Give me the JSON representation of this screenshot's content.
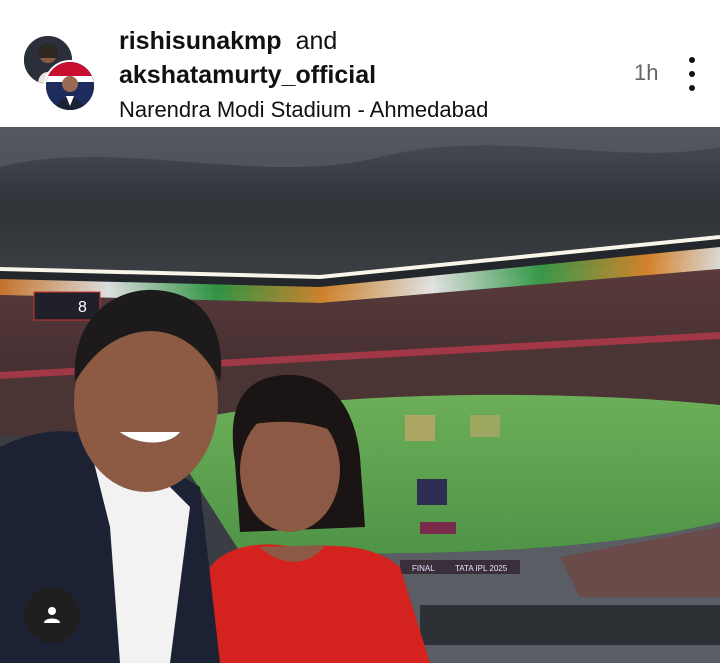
{
  "post": {
    "user1": "rishisunakmp",
    "conjunction": "and",
    "user2": "akshatamurty_official",
    "location": "Narendra Modi Stadium - Ahmedabad",
    "time": "1h"
  },
  "photo": {
    "scoreboard": "8",
    "board_text": "FINAL",
    "board_text2": "TATA IPL 2025"
  },
  "icons": {
    "more": "more-vertical-icon",
    "tag": "user-tag-icon"
  },
  "colors": {
    "text": "#111111",
    "muted": "#666666",
    "pitch": "#5fa35a"
  }
}
